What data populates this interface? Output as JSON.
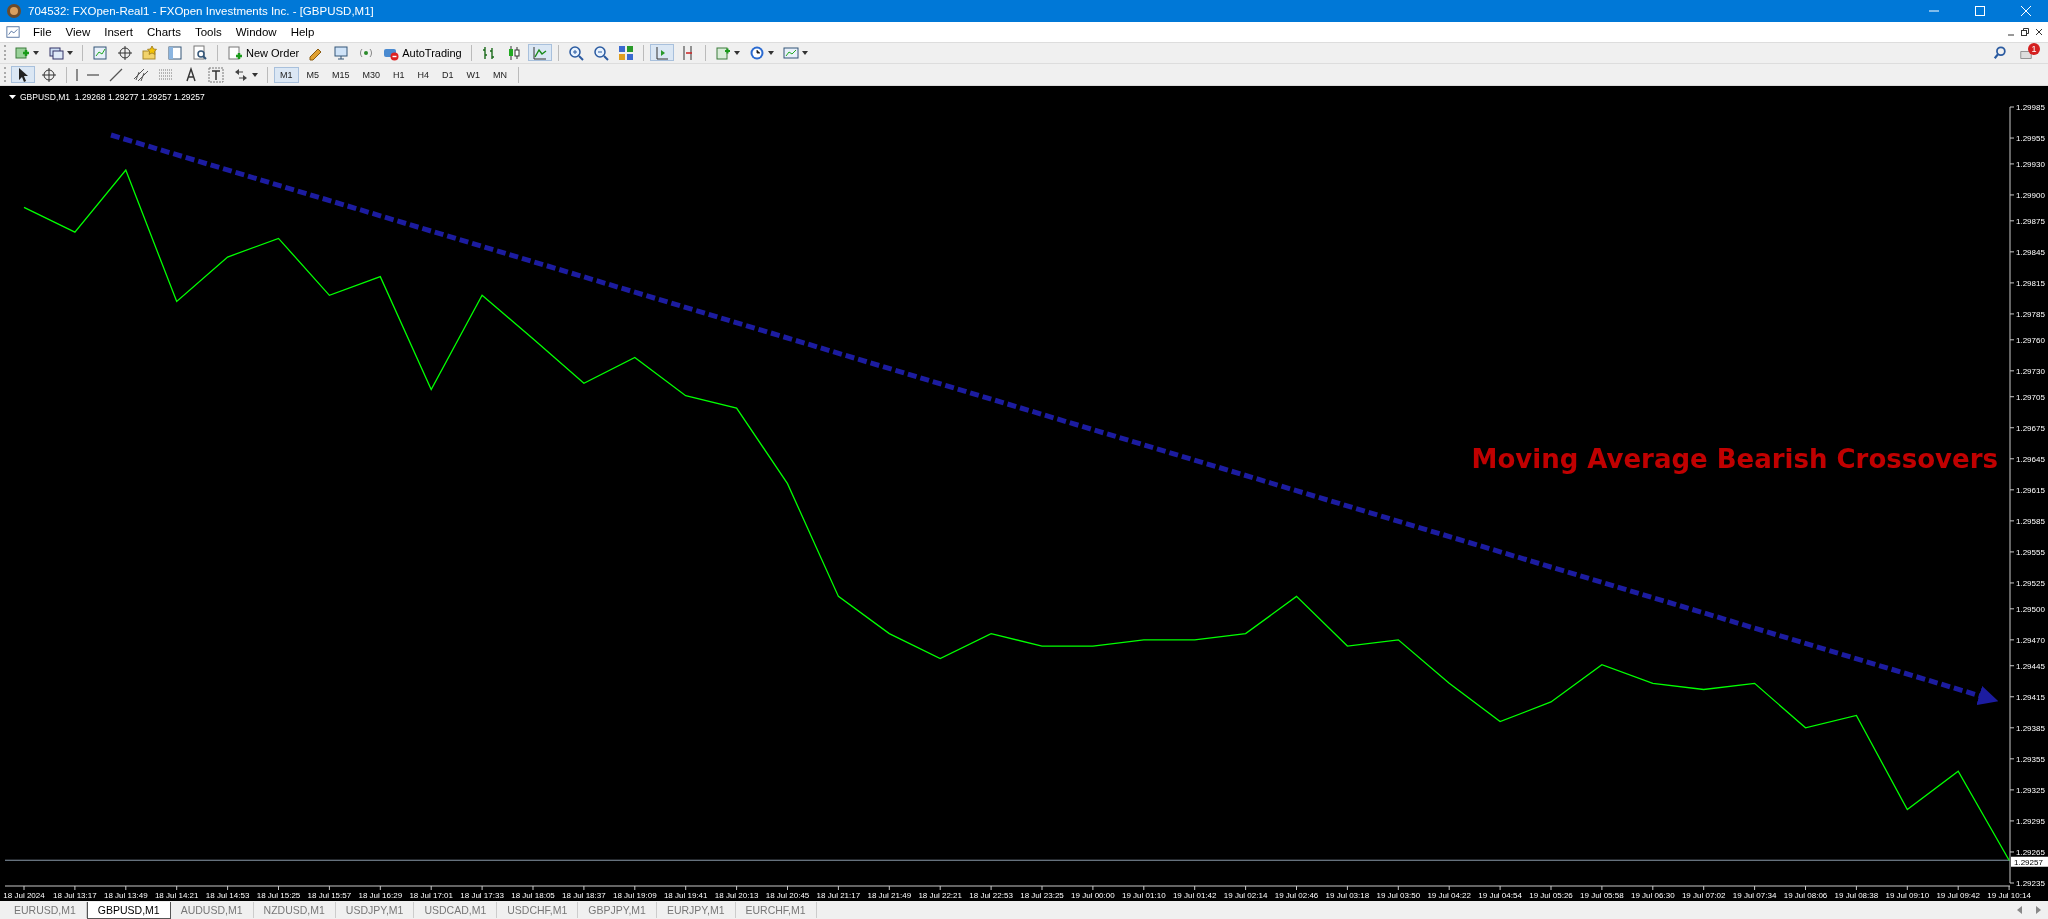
{
  "window": {
    "title": "704532: FXOpen-Real1 - FXOpen Investments Inc. - [GBPUSD,M1]"
  },
  "menu": [
    "File",
    "View",
    "Insert",
    "Charts",
    "Tools",
    "Window",
    "Help"
  ],
  "toolbar": {
    "new_order": "New Order",
    "auto_trading": "AutoTrading",
    "notification_badge": "1"
  },
  "timeframes": [
    {
      "label": "M1",
      "selected": true
    },
    {
      "label": "M5",
      "selected": false
    },
    {
      "label": "M15",
      "selected": false
    },
    {
      "label": "M30",
      "selected": false
    },
    {
      "label": "H1",
      "selected": false
    },
    {
      "label": "H4",
      "selected": false
    },
    {
      "label": "D1",
      "selected": false
    },
    {
      "label": "W1",
      "selected": false
    },
    {
      "label": "MN",
      "selected": false
    }
  ],
  "chart": {
    "header_quote": "1.29268 1.29277 1.29257 1.29257",
    "annotation": "Moving Average Bearish Crossovers",
    "chart_data": {
      "type": "line",
      "categories": [
        "18 Jul 2024",
        "18 Jul 13:17",
        "18 Jul 13:49",
        "18 Jul 14:21",
        "18 Jul 14:53",
        "18 Jul 15:25",
        "18 Jul 15:57",
        "18 Jul 16:29",
        "18 Jul 17:01",
        "18 Jul 17:33",
        "18 Jul 18:05",
        "18 Jul 18:37",
        "18 Jul 19:09",
        "18 Jul 19:41",
        "18 Jul 20:13",
        "18 Jul 20:45",
        "18 Jul 21:17",
        "18 Jul 21:49",
        "18 Jul 22:21",
        "18 Jul 22:53",
        "18 Jul 23:25",
        "19 Jul 00:00",
        "19 Jul 01:10",
        "19 Jul 01:42",
        "19 Jul 02:14",
        "19 Jul 02:46",
        "19 Jul 03:18",
        "19 Jul 03:50",
        "19 Jul 04:22",
        "19 Jul 04:54",
        "19 Jul 05:26",
        "19 Jul 05:58",
        "19 Jul 06:30",
        "19 Jul 07:02",
        "19 Jul 07:34",
        "19 Jul 08:06",
        "19 Jul 08:38",
        "19 Jul 09:10",
        "19 Jul 09:42",
        "19 Jul 10:14"
      ],
      "series": [
        {
          "name": "GBPUSD,M1",
          "color": "#00ff00",
          "values": [
            1.29888,
            1.29864,
            1.29924,
            1.29797,
            1.2984,
            1.29858,
            1.29803,
            1.29821,
            1.29712,
            1.29803,
            1.29761,
            1.29718,
            1.29743,
            1.29706,
            1.29694,
            1.29621,
            1.29512,
            1.29476,
            1.29452,
            1.29476,
            1.29464,
            1.29464,
            1.2947,
            1.2947,
            1.29476,
            1.29512,
            1.29464,
            1.2947,
            1.29428,
            1.29391,
            1.2941,
            1.29446,
            1.29428,
            1.29422,
            1.29428,
            1.29385,
            1.29397,
            1.29306,
            1.29343,
            1.29257
          ]
        }
      ],
      "ref_lines": [
        {
          "axis": "y",
          "value": 1.29257,
          "label": "1.29257"
        }
      ],
      "ylim": [
        1.29235,
        1.29985
      ],
      "yticks": [
        {
          "value": 1.29985,
          "label": "1.29985"
        },
        {
          "value": 1.29955,
          "label": "1.29955"
        },
        {
          "value": 1.2993,
          "label": "1.29930"
        },
        {
          "value": 1.299,
          "label": "1.29900"
        },
        {
          "value": 1.29875,
          "label": "1.29875"
        },
        {
          "value": 1.29845,
          "label": "1.29845"
        },
        {
          "value": 1.29815,
          "label": "1.29815"
        },
        {
          "value": 1.29785,
          "label": "1.29785"
        },
        {
          "value": 1.2976,
          "label": "1.29760"
        },
        {
          "value": 1.2973,
          "label": "1.29730"
        },
        {
          "value": 1.29705,
          "label": "1.29705"
        },
        {
          "value": 1.29675,
          "label": "1.29675"
        },
        {
          "value": 1.29645,
          "label": "1.29645"
        },
        {
          "value": 1.29615,
          "label": "1.29615"
        },
        {
          "value": 1.29585,
          "label": "1.29585"
        },
        {
          "value": 1.29555,
          "label": "1.29555"
        },
        {
          "value": 1.29525,
          "label": "1.29525"
        },
        {
          "value": 1.295,
          "label": "1.29500"
        },
        {
          "value": 1.2947,
          "label": "1.29470"
        },
        {
          "value": 1.29445,
          "label": "1.29445"
        },
        {
          "value": 1.29415,
          "label": "1.29415"
        },
        {
          "value": 1.29385,
          "label": "1.29385"
        },
        {
          "value": 1.29355,
          "label": "1.29355"
        },
        {
          "value": 1.29325,
          "label": "1.29325"
        },
        {
          "value": 1.29295,
          "label": "1.29295"
        },
        {
          "value": 1.29265,
          "label": "1.29265"
        },
        {
          "value": 1.29235,
          "label": "1.29235"
        }
      ]
    }
  },
  "tabs": [
    {
      "label": "EURUSD,M1",
      "selected": false
    },
    {
      "label": "GBPUSD,M1",
      "selected": true
    },
    {
      "label": "AUDUSD,M1",
      "selected": false
    },
    {
      "label": "NZDUSD,M1",
      "selected": false
    },
    {
      "label": "USDJPY,M1",
      "selected": false
    },
    {
      "label": "USDCAD,M1",
      "selected": false
    },
    {
      "label": "USDCHF,M1",
      "selected": false
    },
    {
      "label": "GBPJPY,M1",
      "selected": false
    },
    {
      "label": "EURJPY,M1",
      "selected": false
    },
    {
      "label": "EURCHF,M1",
      "selected": false
    }
  ]
}
